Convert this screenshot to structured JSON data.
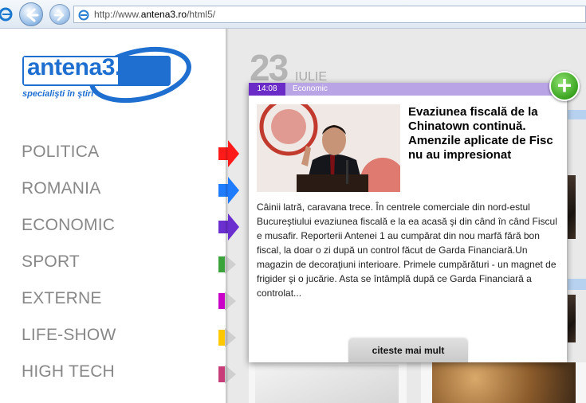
{
  "browser": {
    "url_prefix": "http://www.",
    "url_domain": "antena3.ro",
    "url_path": "/html5/"
  },
  "logo": {
    "brand": "antena3.ro",
    "tagline": "specialişti în ştiri"
  },
  "menu": [
    {
      "label": "POLITICA",
      "color": "#ff1a1a",
      "style": "big"
    },
    {
      "label": "ROMANIA",
      "color": "#1f7bff",
      "style": "big"
    },
    {
      "label": "ECONOMIC",
      "color": "#6b2fd0",
      "style": "big"
    },
    {
      "label": "SPORT",
      "color": "#3aa43a",
      "style": "small"
    },
    {
      "label": "EXTERNE",
      "color": "#c800c8",
      "style": "small"
    },
    {
      "label": "LIFE-SHOW",
      "color": "#ffc800",
      "style": "small"
    },
    {
      "label": "HIGH TECH",
      "color": "#c83c7a",
      "style": "small"
    }
  ],
  "date": {
    "day": "23",
    "month": "IULIE"
  },
  "popup": {
    "time": "14:08",
    "category": "Economic",
    "headline": "Evaziunea fiscală de la Chinatown continuă. Amenzile aplicate de Fisc nu au impresionat",
    "body": "Câinii latră, caravana trece. În centrele comerciale din nord-estul Bucureştiului evaziunea fiscală e la ea acasă şi din când în când Fiscul e musafir. Reporterii Antenei 1 au cumpărat din nou marfă fără bon fiscal, la doar o zi după un control făcut de Garda Financiară.Un magazin de decoraţiuni interioare. Primele cumpărături - un magnet de frigider şi o jucărie. Asta se întâmplă după ce Garda Financiară a controlat...",
    "more_label": "citeste mai mult"
  },
  "colors": {
    "accent_purple": "#6a2bc6",
    "bar_lavender": "#b9a4e6",
    "plus_green": "#3aa31f"
  }
}
